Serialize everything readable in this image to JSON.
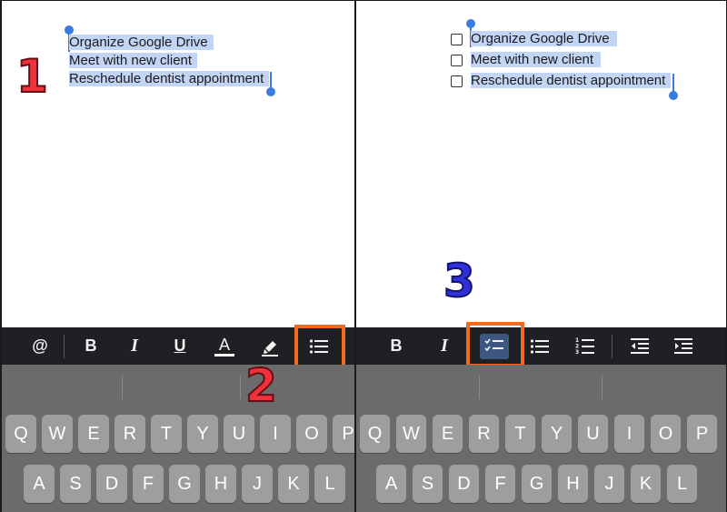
{
  "left_panel": {
    "lines": [
      "Organize Google Drive",
      "Meet with new client",
      "Reschedule dentist appointment"
    ],
    "step_marker": "1",
    "step_marker_2": "2",
    "toolbar": {
      "at": "@",
      "bold": "B",
      "italic": "I",
      "underline": "U",
      "text_color": "A",
      "highlight_icon": "highlighter-icon",
      "list_icon": "bulleted-list-icon"
    },
    "keys_row1": [
      "Q",
      "W",
      "E",
      "R",
      "T",
      "Y",
      "U",
      "I",
      "O",
      "P"
    ],
    "keys_row2": [
      "A",
      "S",
      "D",
      "F",
      "G",
      "H",
      "J",
      "K",
      "L"
    ]
  },
  "right_panel": {
    "lines": [
      "Organize Google Drive",
      "Meet with new client",
      "Reschedule dentist appointment"
    ],
    "step_marker": "3",
    "toolbar": {
      "bold": "B",
      "italic": "I",
      "checklist_icon": "checklist-icon",
      "bullet_icon": "bulleted-list-icon",
      "numbered_icon": "numbered-list-icon",
      "outdent_icon": "decrease-indent-icon",
      "indent_icon": "increase-indent-icon"
    },
    "keys_row1": [
      "Q",
      "W",
      "E",
      "R",
      "T",
      "Y",
      "U",
      "I",
      "O",
      "P"
    ],
    "keys_row2": [
      "A",
      "S",
      "D",
      "F",
      "G",
      "H",
      "J",
      "K",
      "L"
    ]
  },
  "colors": {
    "selection": "#c3d5f5",
    "handle": "#3a7be0",
    "highlight_box": "#f26a1c",
    "toolbar_bg": "#1e2023",
    "keyboard_bg": "#6b6b6b",
    "key_bg": "#9e9e9e",
    "marker_red": "#f0323c",
    "marker_blue": "#2f2fdc"
  }
}
